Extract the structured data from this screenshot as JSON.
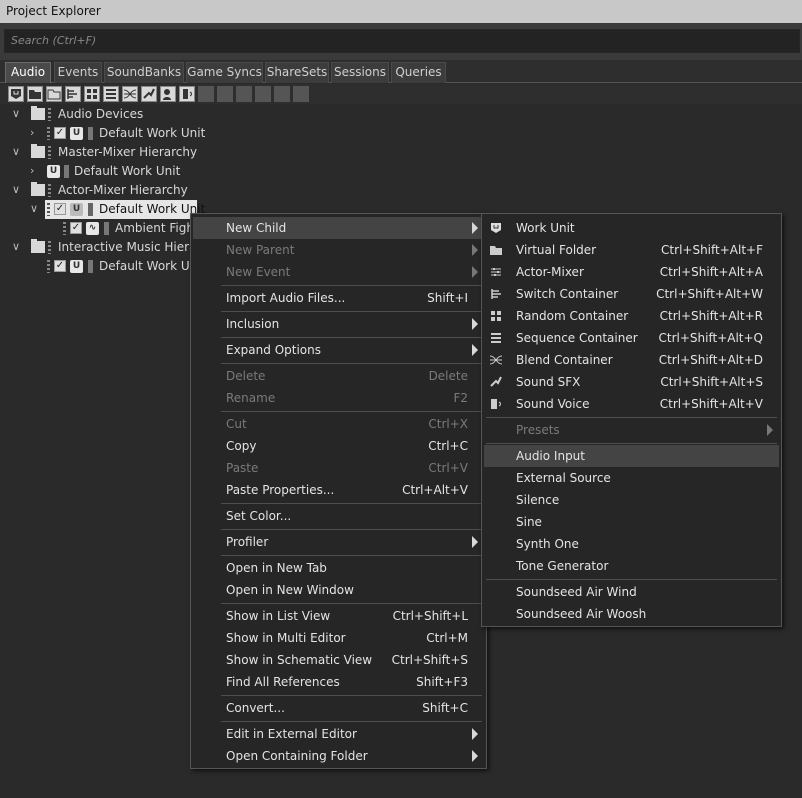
{
  "window": {
    "title": "Project Explorer"
  },
  "search": {
    "placeholder": "Search (Ctrl+F)"
  },
  "tabs": [
    "Audio",
    "Events",
    "SoundBanks",
    "Game Syncs",
    "ShareSets",
    "Sessions",
    "Queries"
  ],
  "toolbar_icons": [
    "work-unit-icon",
    "folder-icon",
    "virtual-folder-icon",
    "switch-container-icon",
    "random-container-icon",
    "sequence-container-icon",
    "blend-container-icon",
    "sound-sfx-icon",
    "sound-voice-icon",
    "disabled-tool-1-icon",
    "disabled-tool-2-icon",
    "disabled-tool-3-icon",
    "disabled-tool-4-icon",
    "disabled-tool-5-icon",
    "disabled-tool-6-icon"
  ],
  "tree": {
    "audio_devices": "Audio Devices",
    "audio_devices_wu": "Default Work Unit",
    "master_mixer": "Master-Mixer Hierarchy",
    "master_mixer_wu": "Default Work Unit",
    "actor_mixer": "Actor-Mixer Hierarchy",
    "actor_mixer_wu": "Default Work Unit",
    "ambient_fight": "Ambient Fight",
    "interactive_music": "Interactive Music Hierarc",
    "interactive_music_wu": "Default Work Uni"
  },
  "context_menu": {
    "new_child": "New Child",
    "new_parent": "New Parent",
    "new_event": "New Event",
    "import_audio": {
      "label": "Import Audio Files...",
      "shortcut": "Shift+I"
    },
    "inclusion": "Inclusion",
    "expand_options": "Expand Options",
    "delete": {
      "label": "Delete",
      "shortcut": "Delete"
    },
    "rename": {
      "label": "Rename",
      "shortcut": "F2"
    },
    "cut": {
      "label": "Cut",
      "shortcut": "Ctrl+X"
    },
    "copy": {
      "label": "Copy",
      "shortcut": "Ctrl+C"
    },
    "paste": {
      "label": "Paste",
      "shortcut": "Ctrl+V"
    },
    "paste_properties": {
      "label": "Paste Properties...",
      "shortcut": "Ctrl+Alt+V"
    },
    "set_color": "Set Color...",
    "profiler": "Profiler",
    "open_new_tab": "Open in New Tab",
    "open_new_window": "Open in New Window",
    "show_list_view": {
      "label": "Show in List View",
      "shortcut": "Ctrl+Shift+L"
    },
    "show_multi_editor": {
      "label": "Show in Multi Editor",
      "shortcut": "Ctrl+M"
    },
    "show_schematic": {
      "label": "Show in Schematic View",
      "shortcut": "Ctrl+Shift+S"
    },
    "find_refs": {
      "label": "Find All References",
      "shortcut": "Shift+F3"
    },
    "convert": {
      "label": "Convert...",
      "shortcut": "Shift+C"
    },
    "edit_external": "Edit in External Editor",
    "open_folder": "Open Containing Folder"
  },
  "submenu": {
    "work_unit": "Work Unit",
    "virtual_folder": {
      "label": "Virtual Folder",
      "shortcut": "Ctrl+Shift+Alt+F"
    },
    "actor_mixer": {
      "label": "Actor-Mixer",
      "shortcut": "Ctrl+Shift+Alt+A"
    },
    "switch_container": {
      "label": "Switch Container",
      "shortcut": "Ctrl+Shift+Alt+W"
    },
    "random_container": {
      "label": "Random Container",
      "shortcut": "Ctrl+Shift+Alt+R"
    },
    "sequence_container": {
      "label": "Sequence Container",
      "shortcut": "Ctrl+Shift+Alt+Q"
    },
    "blend_container": {
      "label": "Blend Container",
      "shortcut": "Ctrl+Shift+Alt+D"
    },
    "sound_sfx": {
      "label": "Sound SFX",
      "shortcut": "Ctrl+Shift+Alt+S"
    },
    "sound_voice": {
      "label": "Sound Voice",
      "shortcut": "Ctrl+Shift+Alt+V"
    },
    "presets": "Presets",
    "audio_input": "Audio Input",
    "external_source": "External Source",
    "silence": "Silence",
    "sine": "Sine",
    "synth_one": "Synth One",
    "tone_generator": "Tone Generator",
    "air_wind": "Soundseed Air Wind",
    "air_woosh": "Soundseed Air Woosh"
  }
}
